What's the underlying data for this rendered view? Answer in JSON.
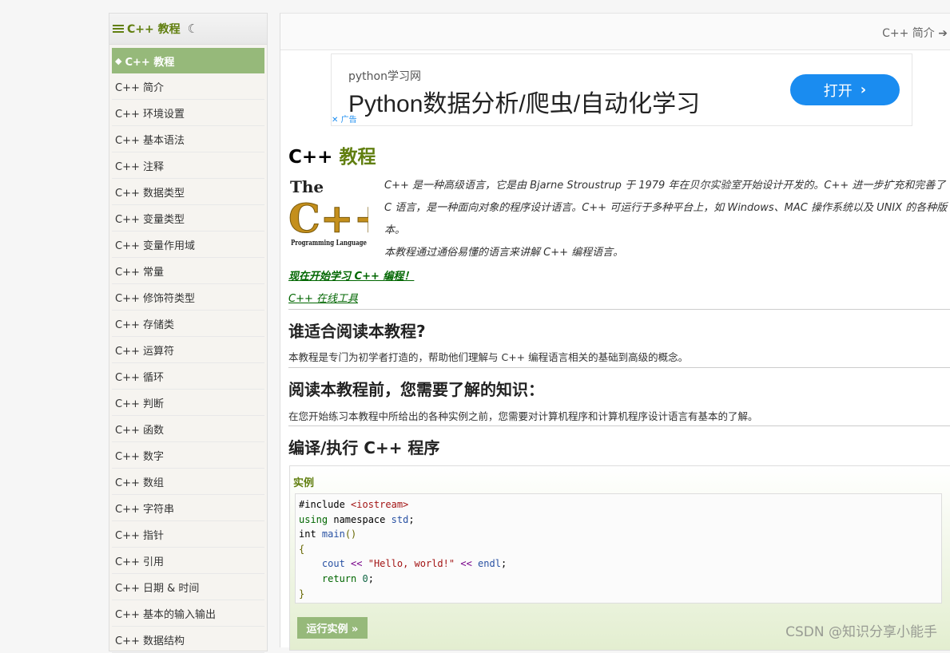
{
  "sidebar": {
    "header_title": "C++ 教程",
    "active_item": "C++ 教程",
    "items": [
      "C++ 简介",
      "C++ 环境设置",
      "C++ 基本语法",
      "C++ 注释",
      "C++ 数据类型",
      "C++ 变量类型",
      "C++ 变量作用域",
      "C++ 常量",
      "C++ 修饰符类型",
      "C++ 存储类",
      "C++ 运算符",
      "C++ 循环",
      "C++ 判断",
      "C++ 函数",
      "C++ 数字",
      "C++ 数组",
      "C++ 字符串",
      "C++ 指针",
      "C++ 引用",
      "C++ 日期 & 时间",
      "C++ 基本的输入输出",
      "C++ 数据结构"
    ]
  },
  "topnav": {
    "next_label": "C++ 简介"
  },
  "ad": {
    "source": "python学习网",
    "title": "Python数据分析/爬虫/自动化学习",
    "button": "打开",
    "mark": "广告"
  },
  "content": {
    "title_prefix": "C++",
    "title_accent": "教程",
    "logo_text": {
      "the": "The",
      "cpp": "C++",
      "sub": "Programming Language"
    },
    "intro_1": "C++ 是一种高级语言，它是由 Bjarne Stroustrup 于 1979 年在贝尔实验室开始设计开发的。C++ 进一步扩充和完善了 C 语言，是一种面向对象的程序设计语言。C++ 可运行于多种平台上，如 Windows、MAC 操作系统以及 UNIX 的各种版本。",
    "intro_2": "本教程通过通俗易懂的语言来讲解 C++ 编程语言。",
    "start_link": "现在开始学习 C++ 编程！",
    "tool_link": "C++ 在线工具",
    "sec1_title": "谁适合阅读本教程?",
    "sec1_text": "本教程是专门为初学者打造的，帮助他们理解与 C++ 编程语言相关的基础到高级的概念。",
    "sec2_title": "阅读本教程前，您需要了解的知识：",
    "sec2_text": "在您开始练习本教程中所给出的各种实例之前，您需要对计算机程序和计算机程序设计语言有基本的了解。",
    "sec3_title": "编译/执行 C++ 程序"
  },
  "example": {
    "label": "实例",
    "run_button": "运行实例 »",
    "code": {
      "include_kw": "#include",
      "include_file": "<iostream>",
      "using_kw": "using",
      "namespace_kw": "namespace",
      "std": "std",
      "int_kw": "int",
      "main_fn": "main",
      "cout": "cout",
      "string": "\"Hello, world!\"",
      "endl": "endl",
      "return_kw": "return",
      "zero": "0"
    }
  },
  "watermark": "CSDN @知识分享小能手"
}
